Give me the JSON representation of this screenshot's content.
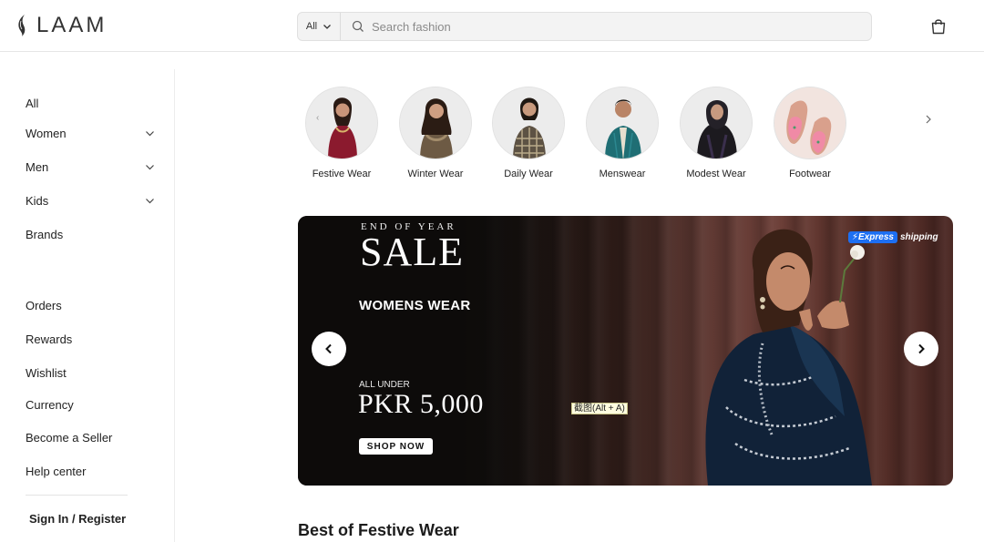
{
  "header": {
    "logo": "LAAM",
    "search": {
      "category": "All",
      "placeholder": "Search fashion"
    }
  },
  "sidebar": {
    "items": [
      {
        "label": "All"
      },
      {
        "label": "Women"
      },
      {
        "label": "Men"
      },
      {
        "label": "Kids"
      },
      {
        "label": "Brands"
      },
      {
        "label": "Orders"
      },
      {
        "label": "Rewards"
      },
      {
        "label": "Wishlist"
      },
      {
        "label": "Currency"
      },
      {
        "label": "Become a Seller"
      },
      {
        "label": "Help center"
      }
    ],
    "sign_in": "Sign In / Register"
  },
  "categories": [
    {
      "label": "Festive Wear"
    },
    {
      "label": "Winter Wear"
    },
    {
      "label": "Daily Wear"
    },
    {
      "label": "Menswear"
    },
    {
      "label": "Modest Wear"
    },
    {
      "label": "Footwear"
    }
  ],
  "banner": {
    "eyebrow": "END OF YEAR",
    "headline": "SALE",
    "subhead": "WOMENS WEAR",
    "price_prefix": "ALL UNDER",
    "price": "PKR 5,000",
    "cta": "SHOP NOW",
    "express_badge": "⚡Express",
    "express_text": "shipping"
  },
  "tooltip": "截图(Alt + A)",
  "section": {
    "title": "Best of Festive Wear"
  },
  "colors": {
    "accent_blue": "#1d6ff2",
    "banner_dark": "#0d0b0a",
    "curtain": "#6e4039"
  }
}
